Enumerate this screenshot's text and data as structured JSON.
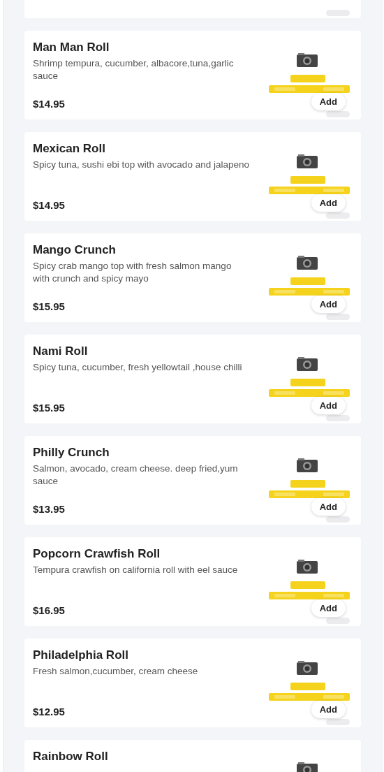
{
  "menu_items": [
    {
      "has_pill": true
    },
    {
      "name": "Man Man Roll",
      "description": "Shrimp tempura, cucumber, albacore,tuna,garlic sauce",
      "price": "$14.95",
      "add_label": "Add",
      "has_pill": true
    },
    {
      "name": "Mexican Roll",
      "description": "Spicy tuna, sushi ebi top with avocado and jalapeno",
      "price": "$14.95",
      "add_label": "Add",
      "has_pill": true
    },
    {
      "name": "Mango Crunch",
      "description": "Spicy crab mango top with fresh salmon mango with crunch and spicy mayo",
      "price": "$15.95",
      "add_label": "Add",
      "has_pill": true
    },
    {
      "name": "Nami Roll",
      "description": "Spicy tuna, cucumber, fresh yellowtail ,house chilli",
      "price": "$15.95",
      "add_label": "Add",
      "has_pill": true
    },
    {
      "name": "Philly Crunch",
      "description": "Salmon, avocado, cream cheese. deep fried,yum sauce",
      "price": "$13.95",
      "add_label": "Add",
      "has_pill": true
    },
    {
      "name": "Popcorn Crawfish Roll",
      "description": "Tempura crawfish on california roll with eel sauce",
      "price": "$16.95",
      "add_label": "Add",
      "has_pill": true
    },
    {
      "name": "Philadelphia Roll",
      "description": "Fresh salmon,cucumber, cream cheese",
      "price": "$12.95",
      "add_label": "Add",
      "has_pill": true
    },
    {
      "name": "Rainbow Roll",
      "image": {
        "kind": "camera"
      }
    }
  ]
}
